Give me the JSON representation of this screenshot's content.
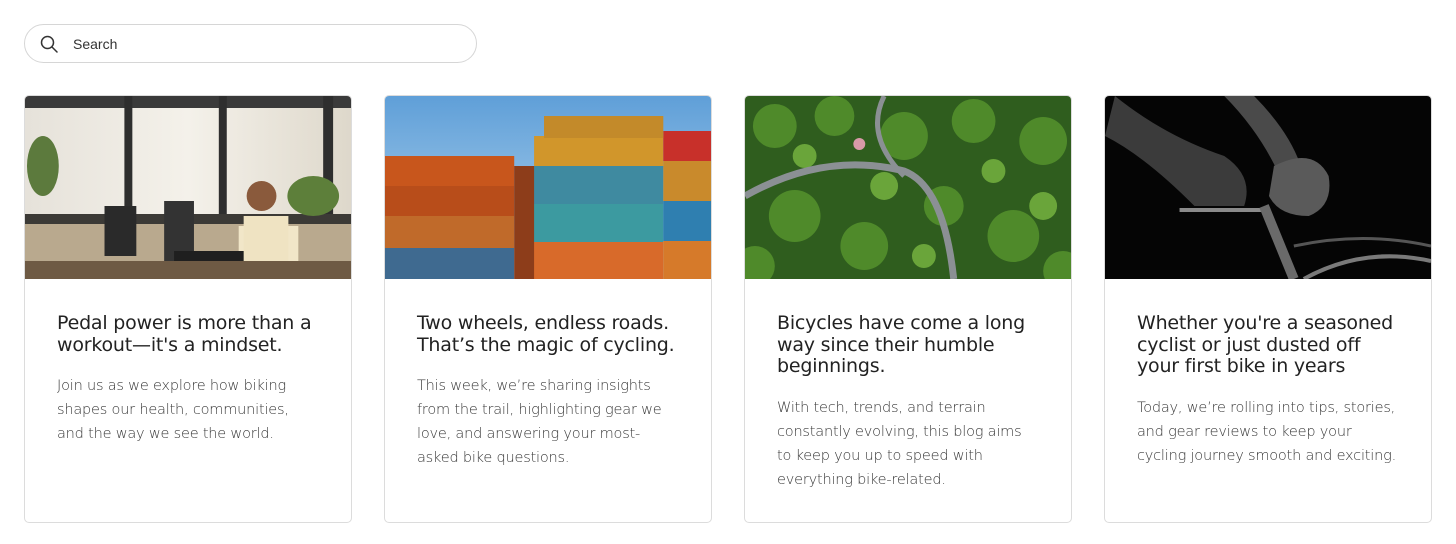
{
  "search": {
    "placeholder": "Search",
    "value": ""
  },
  "cards": [
    {
      "image": "office-worker-with-headphones-photo",
      "title": "Pedal power is more than a workout—it's a mindset.",
      "text": "Join us as we explore how biking shapes our health, communities, and the way we see the world."
    },
    {
      "image": "stacked-shipping-containers-photo",
      "title": "Two wheels, endless roads. That’s the magic of cycling.",
      "text": "This week, we’re sharing insights from the trail, highlighting gear we love, and answering your most-asked bike questions."
    },
    {
      "image": "aerial-forest-road-photo",
      "title": "Bicycles have come a long way since their humble beginnings.",
      "text": "With tech, trends, and terrain constantly evolving, this blog aims to keep you up to speed with everything bike-related."
    },
    {
      "image": "cyclist-black-and-white-photo",
      "title": "Whether you're a seasoned cyclist or just dusted off your first bike in years",
      "text": "Today, we’re rolling into tips, stories, and gear reviews to keep your cycling journey smooth and exciting."
    }
  ]
}
